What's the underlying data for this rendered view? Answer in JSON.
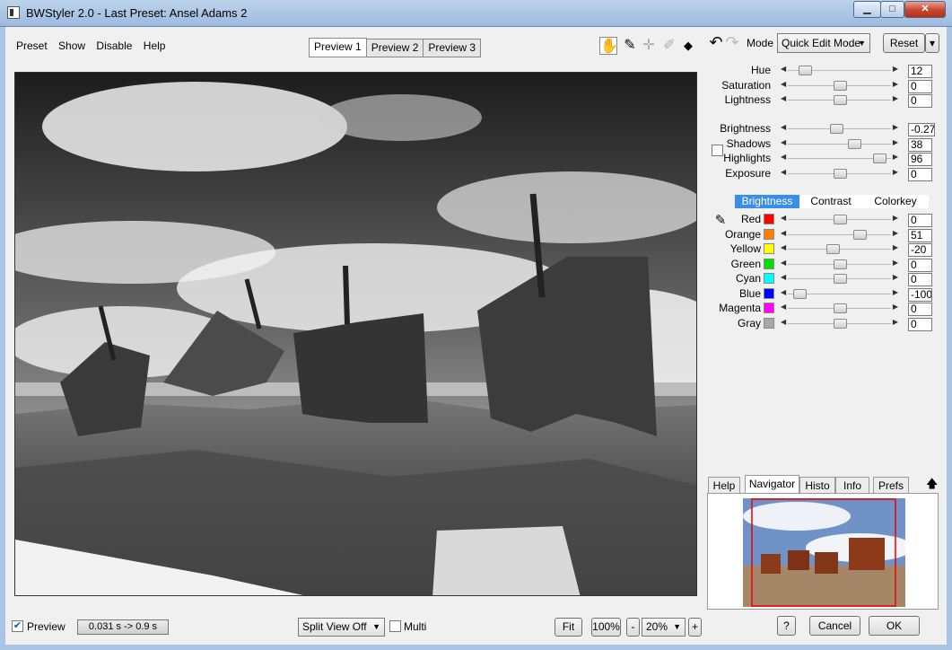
{
  "window": {
    "title": "BWStyler 2.0 - Last Preset: Ansel Adams 2",
    "minimize": "▁",
    "maximize": "□",
    "close": "✕"
  },
  "menu": [
    "Preset",
    "Show",
    "Disable",
    "Help"
  ],
  "preview_tabs": [
    "Preview 1",
    "Preview 2",
    "Preview 3"
  ],
  "tools": {
    "hand": "✋",
    "eyedropper": "✎",
    "crosshair": "✛",
    "brush": "✐",
    "compare": "◆"
  },
  "undo": "↶",
  "redo": "↷",
  "mode": {
    "label": "Mode",
    "value": "Quick Edit Mode"
  },
  "reset": {
    "label": "Reset",
    "dropdown": "▾"
  },
  "hsl": [
    {
      "label": "Hue",
      "value": "12",
      "level": 0.15
    },
    {
      "label": "Saturation",
      "value": "0",
      "level": 0.5
    },
    {
      "label": "Lightness",
      "value": "0",
      "level": 0.5
    }
  ],
  "tone": [
    {
      "label": "Brightness",
      "value": "-0.27",
      "level": 0.47
    },
    {
      "label": "Shadows",
      "value": "38",
      "level": 0.65
    },
    {
      "label": "Highlights",
      "value": "96",
      "level": 0.9
    },
    {
      "label": "Exposure",
      "value": "0",
      "level": 0.5
    }
  ],
  "color_tabs": [
    "Brightness",
    "Contrast",
    "Colorkey"
  ],
  "channels": [
    {
      "label": "Red",
      "value": "0",
      "level": 0.5,
      "color": "#ff0000"
    },
    {
      "label": "Orange",
      "value": "51",
      "level": 0.7,
      "color": "#ff8000"
    },
    {
      "label": "Yellow",
      "value": "-20",
      "level": 0.43,
      "color": "#ffff00"
    },
    {
      "label": "Green",
      "value": "0",
      "level": 0.5,
      "color": "#00e000"
    },
    {
      "label": "Cyan",
      "value": "0",
      "level": 0.5,
      "color": "#00ffff"
    },
    {
      "label": "Blue",
      "value": "-100",
      "level": 0.1,
      "color": "#0000ff"
    },
    {
      "label": "Magenta",
      "value": "0",
      "level": 0.5,
      "color": "#ff00ff"
    },
    {
      "label": "Gray",
      "value": "0",
      "level": 0.5,
      "color": "#a8a8a8"
    }
  ],
  "panel_tabs": [
    "Help",
    "Navigator",
    "Histo",
    "Info",
    "Prefs"
  ],
  "panel_arrow": "🡅",
  "bottom": {
    "preview_label": "Preview",
    "preview_checked": true,
    "timing": "0.031 s -> 0.9 s",
    "split_view": "Split View Off",
    "multi_label": "Multi",
    "fit": "Fit",
    "zoom_100": "100%",
    "zoom_minus": "-",
    "zoom_value": "20%",
    "zoom_plus": "+",
    "help": "?",
    "cancel": "Cancel",
    "ok": "OK"
  },
  "colors": {
    "accent_tab": "#3b8ee8"
  }
}
